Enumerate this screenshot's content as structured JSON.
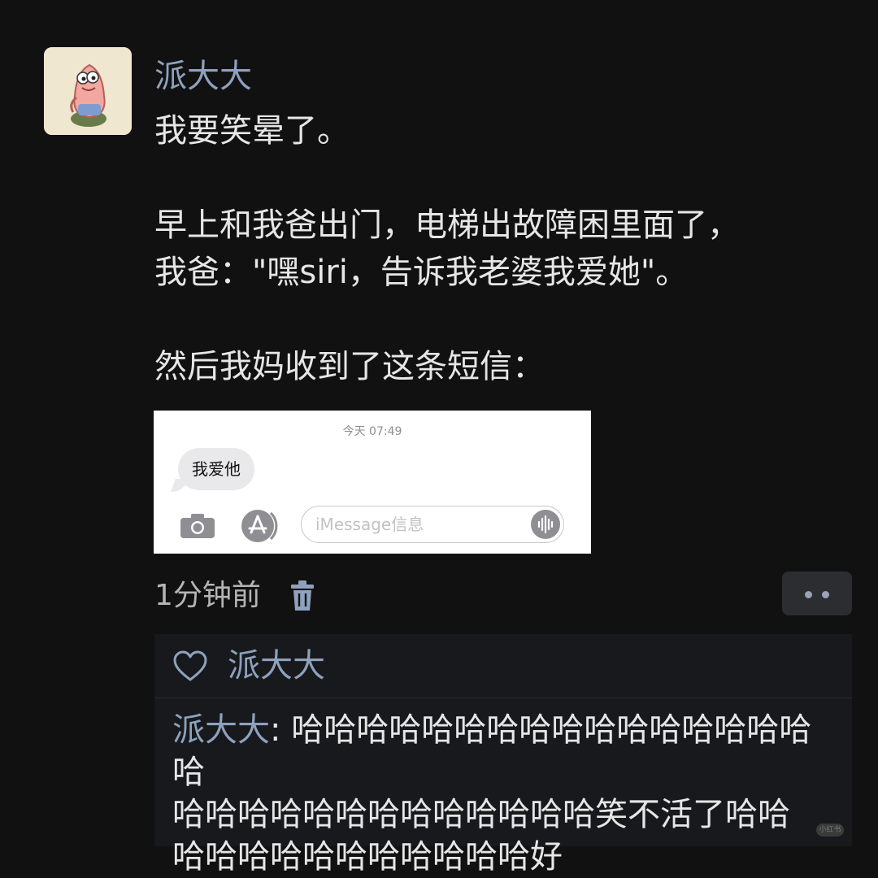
{
  "post": {
    "username": "派大大",
    "lines": [
      "我要笑晕了。",
      "",
      "早上和我爸出门，电梯出故障困里面了，",
      "我爸：\"嘿siri，告诉我老婆我爱她\"。",
      "",
      "然后我妈收到了这条短信："
    ],
    "time_ago": "1分钟前"
  },
  "screenshot": {
    "timestamp": "今天 07:49",
    "message": "我爱他",
    "input_placeholder": "iMessage信息"
  },
  "reply": {
    "liker_name": "派大大",
    "comment_author": "派大大",
    "comment_sep": ": ",
    "comment_lines": [
      "哈哈哈哈哈哈哈哈哈哈哈哈哈哈哈哈哈",
      "哈哈哈哈哈哈哈哈哈哈哈哈哈笑不活了哈哈",
      "哈哈哈哈哈哈哈哈哈哈哈好"
    ]
  },
  "watermark": "小红书",
  "icons": {
    "avatar": "patrick-star-avatar",
    "trash": "trash-icon",
    "more": "more-dots-icon",
    "heart": "heart-outline-icon",
    "camera": "camera-icon",
    "appstore": "app-store-icon",
    "voice": "voice-waveform-icon"
  },
  "colors": {
    "background": "#111111",
    "name": "#8ea1bd",
    "text": "#e6e6e6",
    "reply_box": "#17191c"
  }
}
